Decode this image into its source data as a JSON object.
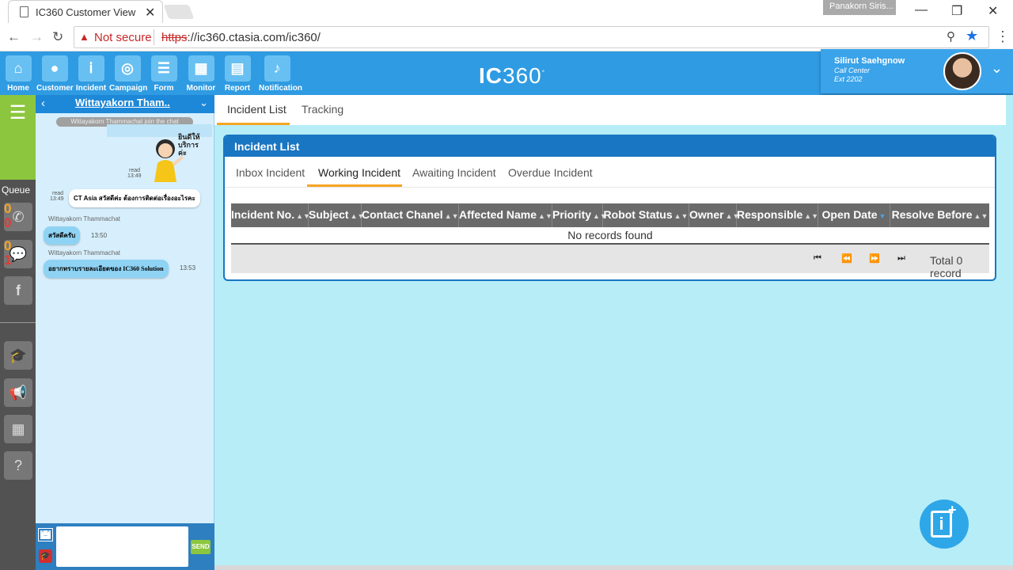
{
  "browser": {
    "tab_title": "IC360 Customer View",
    "tab_close": "✕",
    "profile_name": "Panakorn Siris...",
    "not_secure": "Not secure",
    "url_scheme": "https",
    "url_rest": "://ic360.ctasia.com/ic360/"
  },
  "header": {
    "modules": [
      {
        "label": "Home",
        "icon": "home-icon"
      },
      {
        "label": "Customer",
        "icon": "user-icon"
      },
      {
        "label": "Incident",
        "icon": "incident-icon"
      },
      {
        "label": "Campaign",
        "icon": "target-icon"
      },
      {
        "label": "Form",
        "icon": "form-icon"
      },
      {
        "label": "Monitor",
        "icon": "monitor-icon"
      },
      {
        "label": "Report",
        "icon": "report-icon"
      },
      {
        "label": "Notification",
        "icon": "bell-icon"
      }
    ],
    "logo_ic": "IC",
    "logo_num": "360",
    "user": {
      "name": "Silirut Saehgnow",
      "role": "Call Center",
      "ext": "Ext 2202"
    }
  },
  "sidebar": {
    "queue_label": "Queue",
    "phone_queue": {
      "top": "0",
      "bottom": "0"
    },
    "chat_queue": {
      "top": "0",
      "bottom": "1"
    }
  },
  "chat": {
    "contact_name": "Wittayakorn Tham..",
    "join_message": "Wittayakorn  Thammachat  join  the chat",
    "sticker_text": "ยินดีให้บริการค่ะ",
    "messages": [
      {
        "status": "read",
        "time": "13:49",
        "text": "",
        "kind": "sticker"
      },
      {
        "status": "read",
        "time": "13:49",
        "text": "CT Asia สวัสดีค่ะ ต้องการติดต่อเรื่องอะไรคะ",
        "kind": "agent"
      },
      {
        "sender": "Wittayakorn  Thammachat",
        "time": "13:50",
        "text": "สวัสดีครับ",
        "kind": "customer"
      },
      {
        "sender": "Wittayakorn  Thammachat",
        "time": "13:53",
        "text": "อยากทราบรายละเอียดของ IC360  Solution",
        "kind": "customer"
      }
    ],
    "send_label": "SEND"
  },
  "main": {
    "top_tabs": [
      "Incident List",
      "Tracking"
    ],
    "card_title": "Incident List",
    "incident_tabs": [
      "Inbox Incident",
      "Working Incident",
      "Awaiting Incident",
      "Overdue Incident"
    ],
    "active_incident_tab": "Working Incident",
    "columns": [
      "Incident No.",
      "Subject",
      "Contact Chanel",
      "Affected Name",
      "Priority",
      "Robot Status",
      "Owner",
      "Responsible",
      "Open Date",
      "Resolve Before"
    ],
    "empty_message": "No records found",
    "total_text": "Total 0 record"
  }
}
